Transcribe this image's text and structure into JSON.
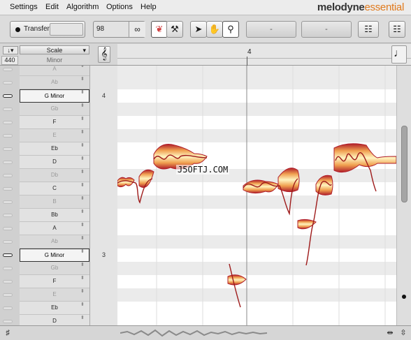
{
  "menu": {
    "items": [
      "Settings",
      "Edit",
      "Algorithm",
      "Options",
      "Help"
    ],
    "brand_part1": "melodyne",
    "brand_part2": "essential"
  },
  "toolbar": {
    "transfer_label": "Transfer",
    "tempo_value": "98",
    "dash1": "-",
    "dash2": "-"
  },
  "scale_header": {
    "scale_label": "Scale",
    "tuning": "440",
    "mode": "Minor"
  },
  "ruler": {
    "bar_label": "4"
  },
  "lanes": [
    {
      "label": "A",
      "state": "dim",
      "bar": ""
    },
    {
      "label": "Ab",
      "state": "dim",
      "bar": ""
    },
    {
      "label": "G Minor",
      "state": "root",
      "bar": "4"
    },
    {
      "label": "Gb",
      "state": "dim",
      "bar": ""
    },
    {
      "label": "F",
      "state": "in",
      "bar": ""
    },
    {
      "label": "E",
      "state": "dim",
      "bar": ""
    },
    {
      "label": "Eb",
      "state": "in",
      "bar": ""
    },
    {
      "label": "D",
      "state": "in",
      "bar": ""
    },
    {
      "label": "Db",
      "state": "dim",
      "bar": ""
    },
    {
      "label": "C",
      "state": "in",
      "bar": ""
    },
    {
      "label": "B",
      "state": "dim",
      "bar": ""
    },
    {
      "label": "Bb",
      "state": "in",
      "bar": ""
    },
    {
      "label": "A",
      "state": "in",
      "bar": ""
    },
    {
      "label": "Ab",
      "state": "dim",
      "bar": ""
    },
    {
      "label": "G Minor",
      "state": "root",
      "bar": "3"
    },
    {
      "label": "Gb",
      "state": "dim",
      "bar": ""
    },
    {
      "label": "F",
      "state": "in",
      "bar": ""
    },
    {
      "label": "E",
      "state": "dim",
      "bar": ""
    },
    {
      "label": "Eb",
      "state": "in",
      "bar": ""
    },
    {
      "label": "D",
      "state": "in",
      "bar": ""
    }
  ],
  "watermark": "J5OFTJ.COM",
  "colors": {
    "blob_outline": "#b01e2a",
    "blob_fill_center": "#fff4c0",
    "blob_fill_mid": "#f0a050",
    "pitch_curve": "#9e1a1a",
    "brand_accent": "#e07a1d"
  }
}
